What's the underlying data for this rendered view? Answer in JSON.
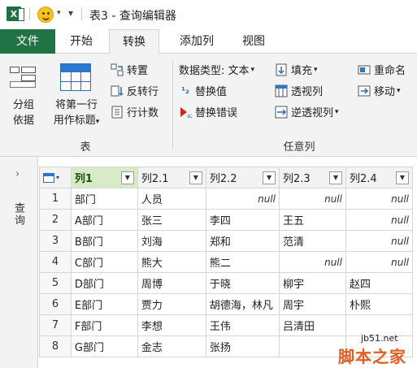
{
  "title_bar": {
    "app_icon_letter": "X",
    "title": "表3 - 查询编辑器"
  },
  "tabs": [
    {
      "label": "文件",
      "active": false,
      "file": true
    },
    {
      "label": "开始",
      "active": false
    },
    {
      "label": "转换",
      "active": true
    },
    {
      "label": "添加列",
      "active": false
    },
    {
      "label": "视图",
      "active": false
    }
  ],
  "ribbon": {
    "table_group": {
      "label": "表",
      "group_by": [
        "分组",
        "依据"
      ],
      "use_first_row": [
        "将第一行",
        "用作标题"
      ],
      "dropdown_caret": "▾",
      "transpose": "转置",
      "reverse_rows": "反转行",
      "count_rows": "行计数"
    },
    "any_column_group": {
      "label": "任意列",
      "data_type": "数据类型: 文本",
      "replace_values": "替换值",
      "replace_errors": "替换错误",
      "fill": "填充",
      "pivot_column": "透视列",
      "unpivot_columns": "逆透视列",
      "rename": "重命名",
      "move": "移动"
    }
  },
  "query_pane": {
    "label": "查询",
    "expand_icon": "chevron-right-icon"
  },
  "grid": {
    "columns": [
      "列1",
      "列2.1",
      "列2.2",
      "列2.3",
      "列2.4"
    ],
    "rows": [
      [
        "1",
        "部门",
        "人员",
        "null",
        "null",
        "null"
      ],
      [
        "2",
        "A部门",
        "张三",
        "李四",
        "王五",
        "null"
      ],
      [
        "3",
        "B部门",
        "刘海",
        "郑和",
        "范清",
        "null"
      ],
      [
        "4",
        "C部门",
        "熊大",
        "熊二",
        "null",
        "null"
      ],
      [
        "5",
        "D部门",
        "周博",
        "于晓",
        "柳宇",
        "赵四"
      ],
      [
        "6",
        "E部门",
        "贾力",
        "胡德海，林凡",
        "周宇",
        "朴熙"
      ],
      [
        "7",
        "F部门",
        "李想",
        "王伟",
        "吕清田",
        ""
      ],
      [
        "8",
        "G部门",
        "金志",
        "张扬",
        "",
        ""
      ]
    ]
  },
  "watermark": {
    "url": "jb51.net",
    "brand": "脚本之家"
  }
}
